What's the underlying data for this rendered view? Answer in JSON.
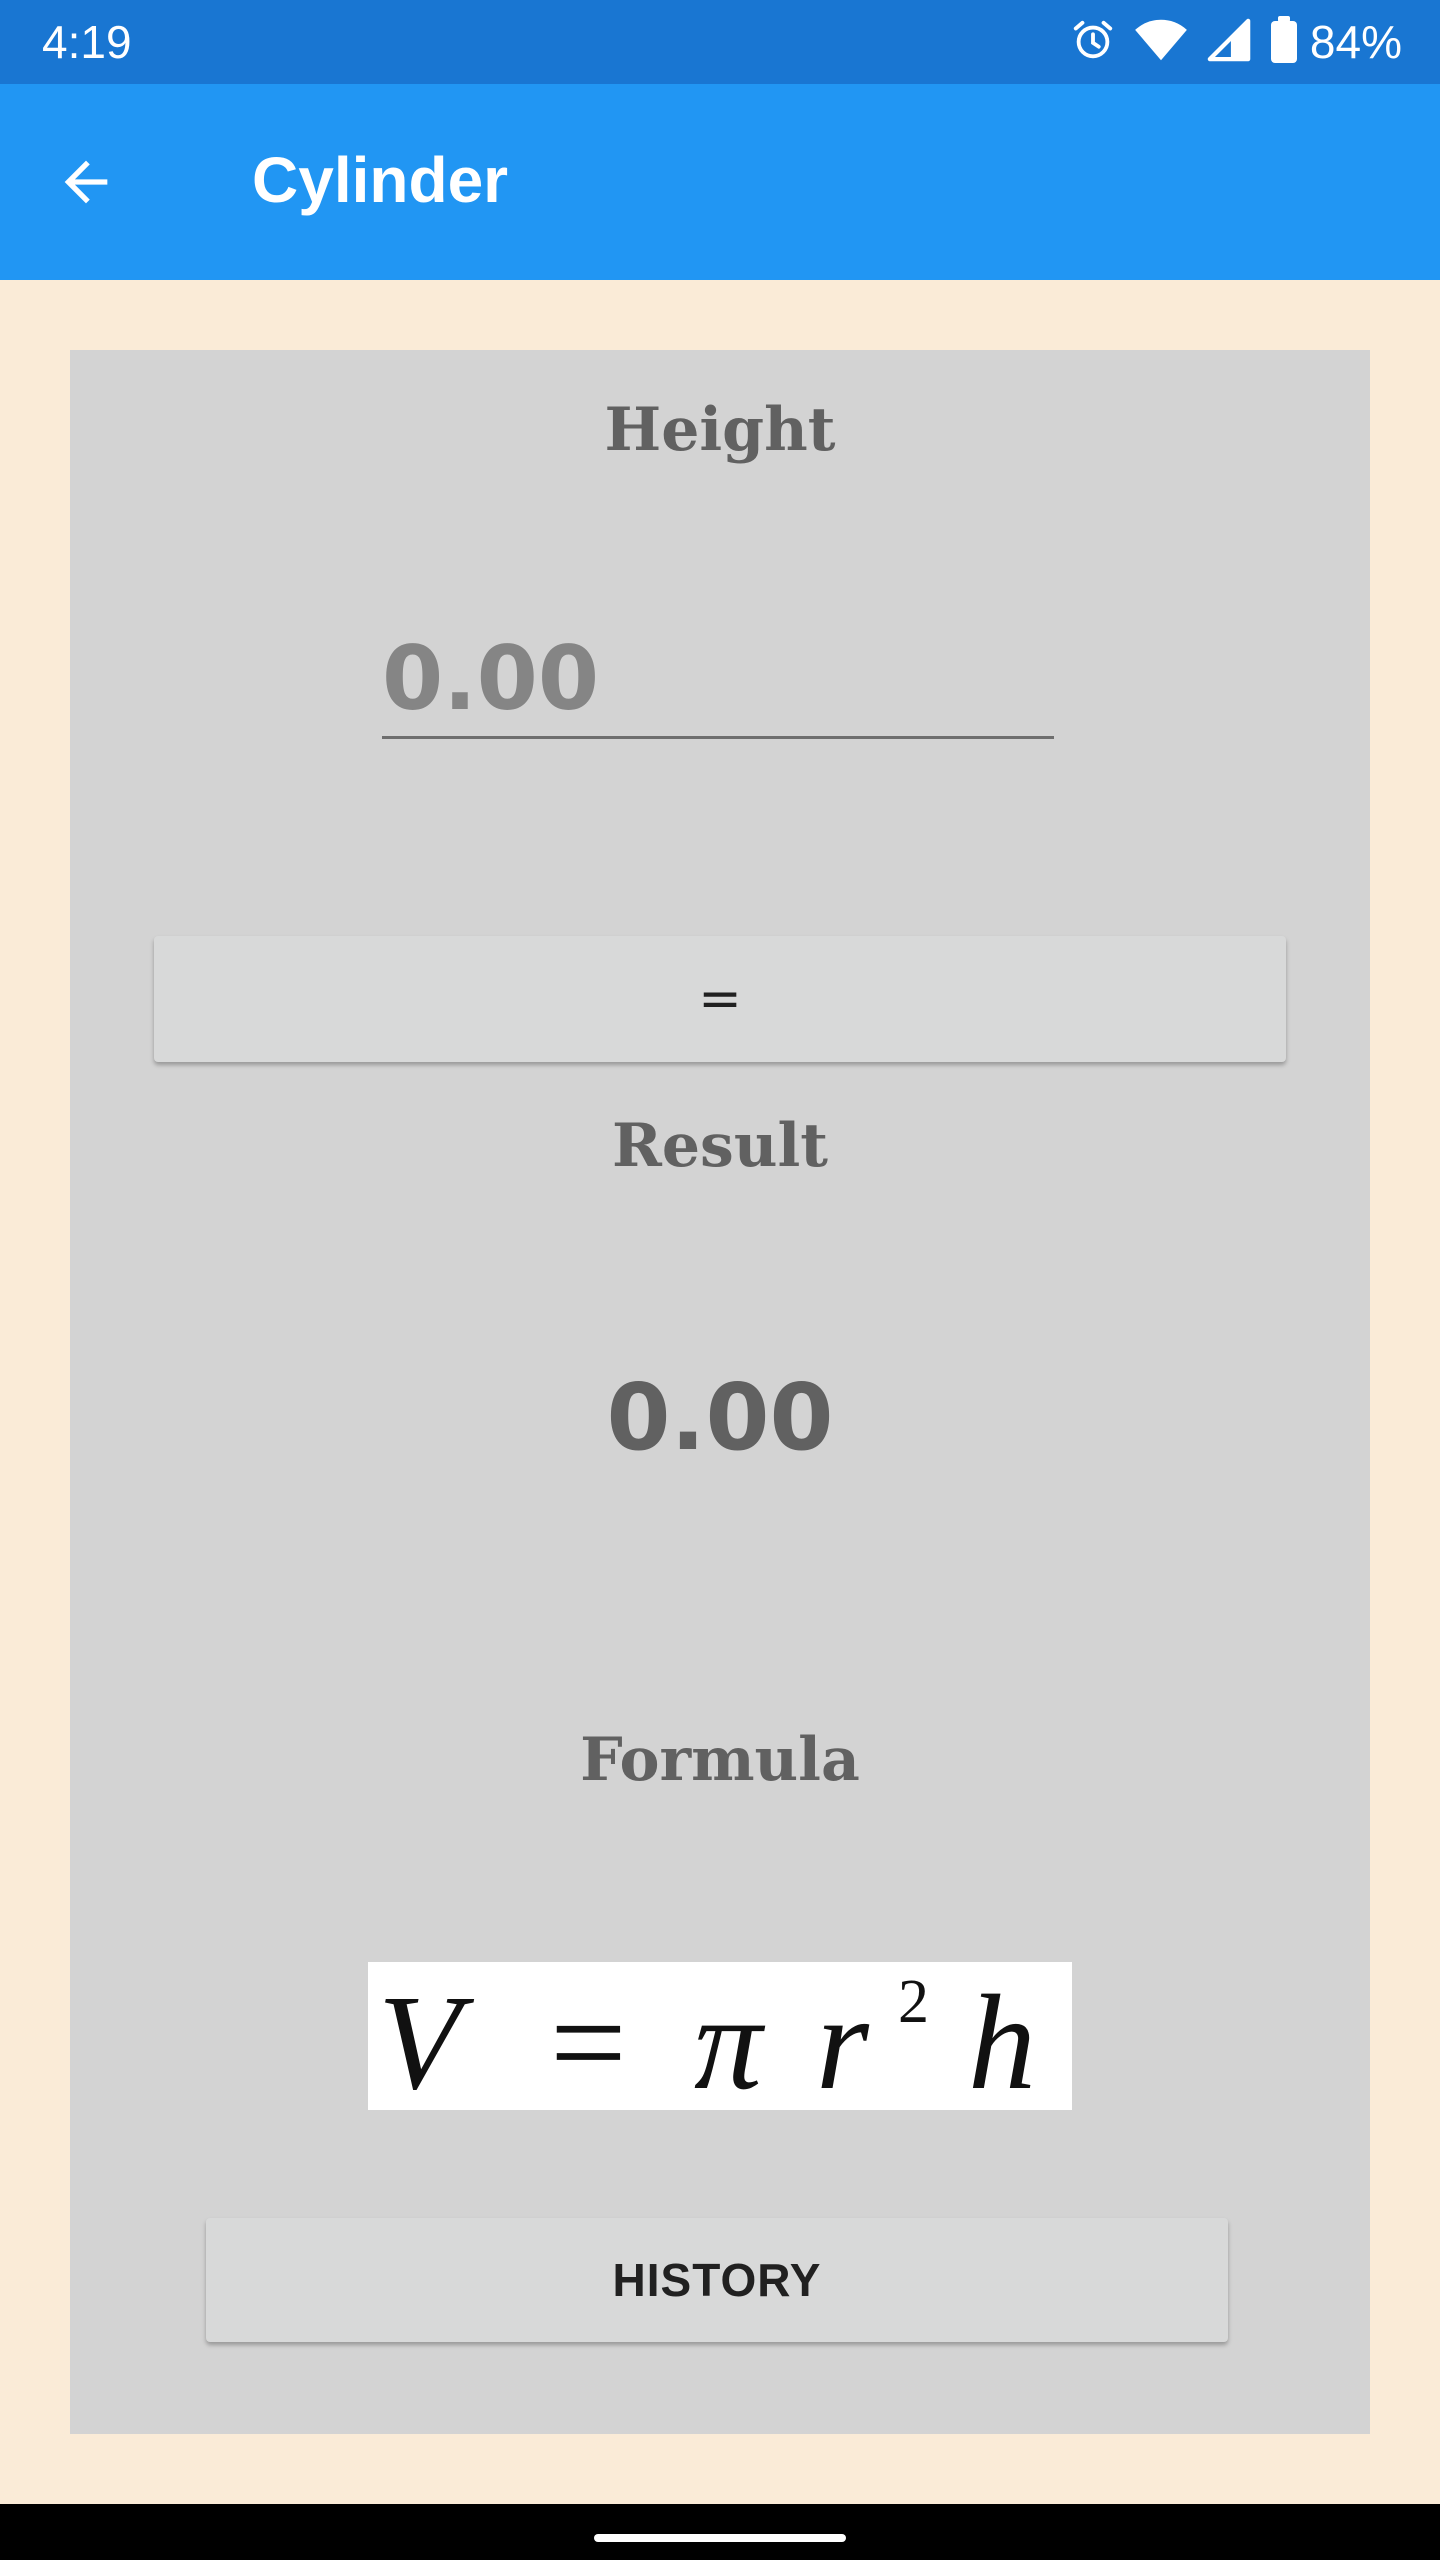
{
  "status_bar": {
    "time": "4:19",
    "battery_percent": "84%",
    "icons": [
      "alarm-icon",
      "wifi-icon",
      "cell-signal-icon",
      "battery-icon"
    ],
    "battery_level": 0.84
  },
  "app_bar": {
    "title": "Cylinder",
    "back_icon": "arrow-back-icon"
  },
  "form": {
    "height_label": "Height",
    "height_input": {
      "value": "",
      "placeholder": "0.00"
    },
    "calculate_label": "=",
    "result_label": "Result",
    "result_value": "0.00",
    "formula_label": "Formula",
    "formula": {
      "lhs": "V",
      "equals": "=",
      "pi": "π",
      "r": "r",
      "exponent": "2",
      "h": "h"
    },
    "history_label": "HISTORY"
  },
  "colors": {
    "status_bar": "#1976D2",
    "app_bar": "#2196F3",
    "background": "#FAEBD7",
    "card": "#D3D3D3",
    "button": "#D8D9D9",
    "label_text": "#616161"
  }
}
